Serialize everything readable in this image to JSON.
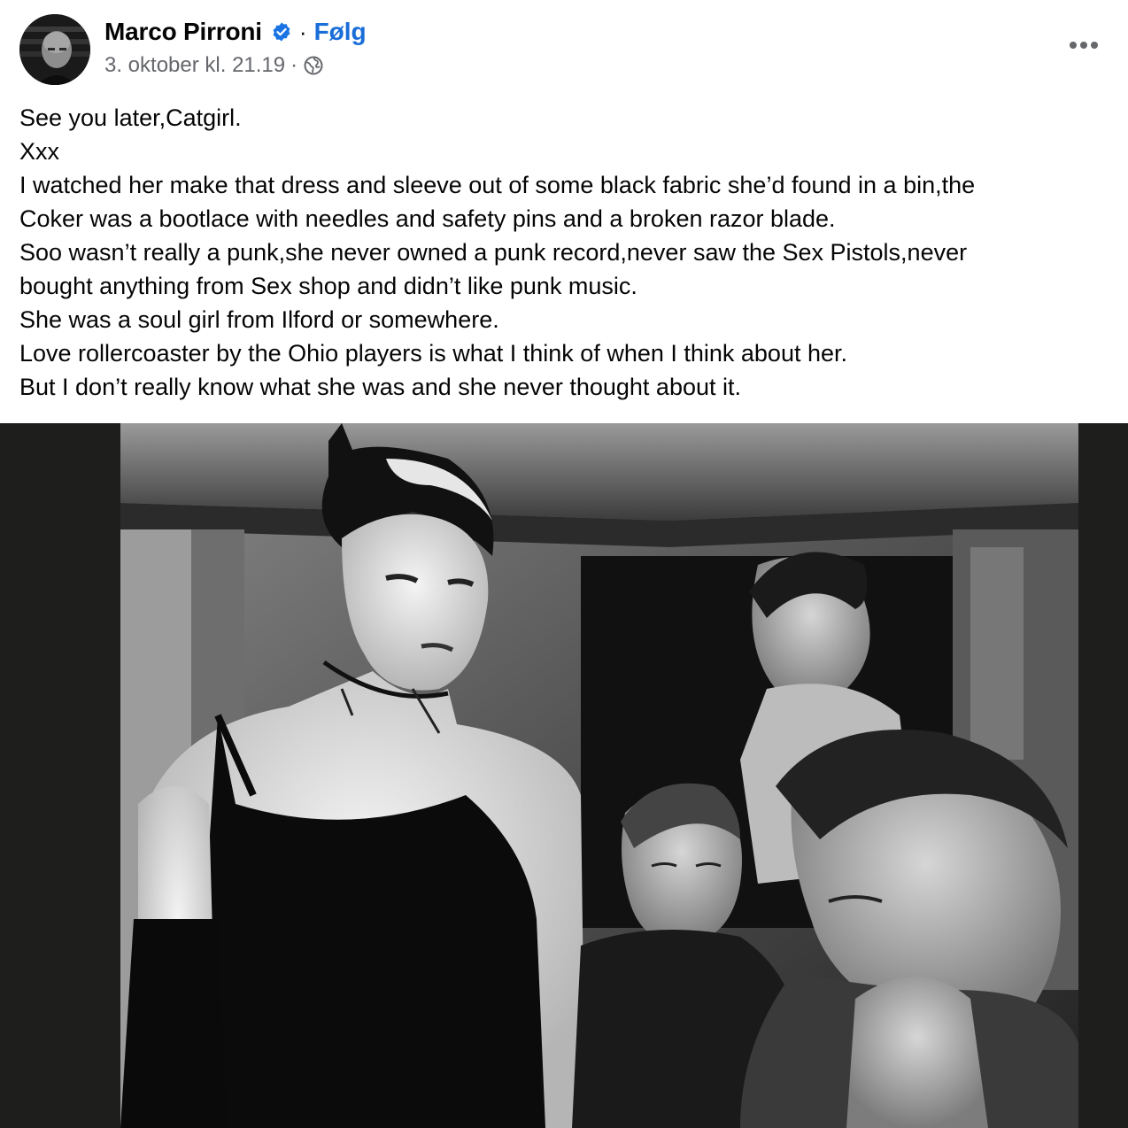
{
  "post": {
    "author": {
      "name": "Marco Pirroni",
      "verified_icon": "verified-badge-icon",
      "follow_label": "Følg",
      "separator": "·"
    },
    "meta": {
      "timestamp": "3. oktober kl. 21.19",
      "separator": "·",
      "audience_icon": "globe-icon"
    },
    "more_icon": "more-options-icon",
    "text_lines": [
      "See you later,Catgirl.",
      "Xxx",
      "I watched her make that dress and sleeve out of some black fabric she’d found in a bin,the",
      "Coker was a bootlace with needles and safety pins and a broken razor blade.",
      "Soo wasn’t really a punk,she never owned a punk record,never saw the Sex Pistols,never",
      "bought anything from Sex shop and didn’t like punk music.",
      "She was a soul girl from Ilford or somewhere.",
      "Love rollercoaster by the Ohio players is what I think of when I think about her.",
      "But I don’t really know what she was and she never thought about it."
    ],
    "photo": {
      "type": "black-and-white photograph"
    }
  },
  "colors": {
    "link_blue": "#1a6ed8",
    "verified_blue": "#1b74e4",
    "meta_gray": "#65676b",
    "photo_backdrop": "#1e1f1c"
  }
}
